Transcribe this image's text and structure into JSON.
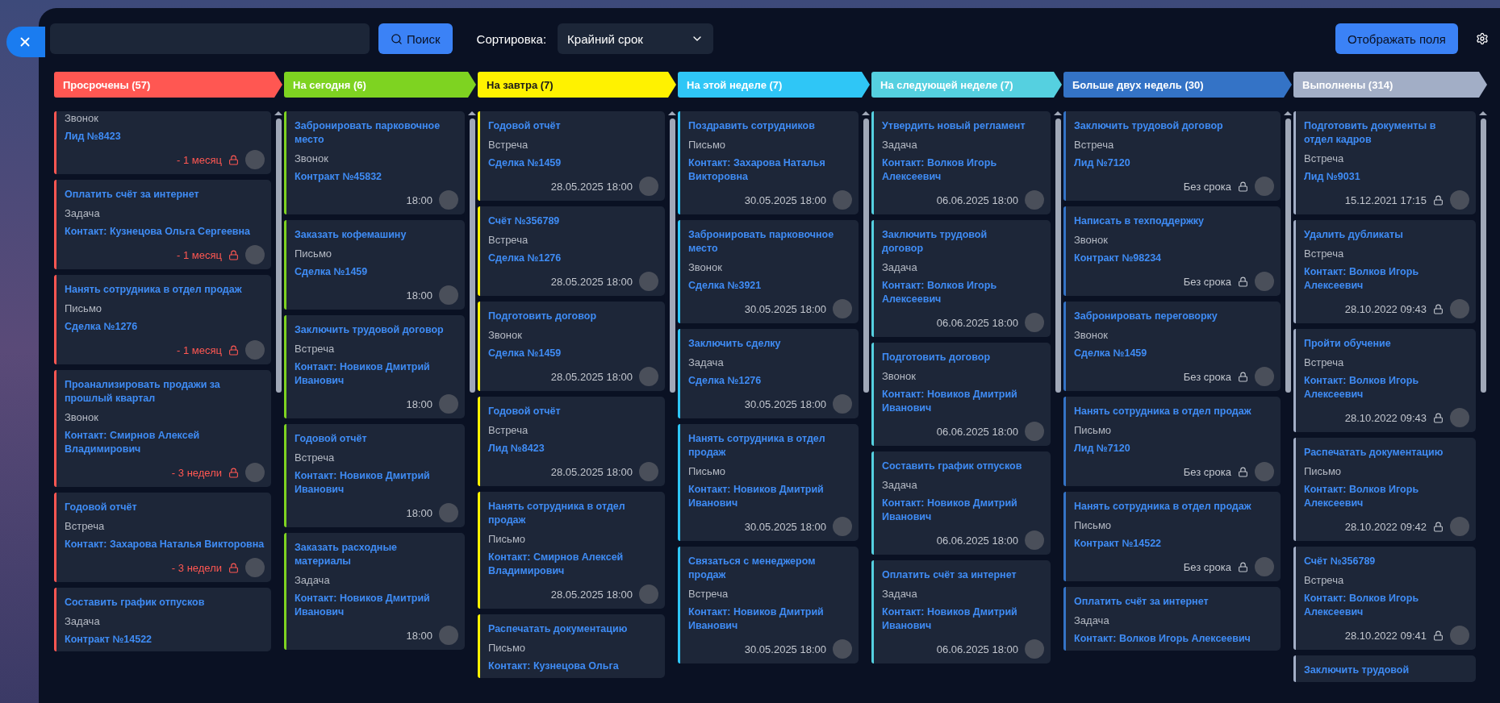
{
  "toolbar": {
    "search_button": "Поиск",
    "sort_label": "Сортировка:",
    "sort_value": "Крайний срок",
    "fields_button": "Отображать поля"
  },
  "columns": [
    {
      "title": "Просрочены (57)",
      "color": "#ff5752",
      "overdue": true,
      "cards": [
        {
          "type": "Звонок",
          "link": "Лид №8423",
          "due": "- 1 месяц",
          "locked": true
        },
        {
          "title": "Оплатить счёт за интернет",
          "type": "Задача",
          "link": "Контакт: Кузнецова Ольга Сергеевна",
          "due": "- 1 месяц",
          "locked": true
        },
        {
          "title": "Нанять сотрудника в отдел продаж",
          "type": "Письмо",
          "link": "Сделка №1276",
          "due": "- 1 месяц",
          "locked": true
        },
        {
          "title": "Проанализировать продажи за прошлый квартал",
          "type": "Звонок",
          "link": "Контакт: Смирнов Алексей Владимирович",
          "due": "- 3 недели",
          "locked": true
        },
        {
          "title": "Годовой отчёт",
          "type": "Встреча",
          "link": "Контакт: Захарова Наталья Викторовна",
          "due": "- 3 недели",
          "locked": true
        },
        {
          "title": "Составить график отпусков",
          "type": "Задача",
          "link": "Контракт №14522"
        }
      ]
    },
    {
      "title": "На сегодня (6)",
      "color": "#7ed321",
      "overdue": false,
      "cards": [
        {
          "title": "Забронировать парковочное место",
          "type": "Звонок",
          "link": "Контракт №45832",
          "due": "18:00",
          "locked": false
        },
        {
          "title": "Заказать кофемашину",
          "type": "Письмо",
          "link": "Сделка №1459",
          "due": "18:00",
          "locked": false
        },
        {
          "title": "Заключить трудовой договор",
          "type": "Встреча",
          "link": "Контакт: Новиков Дмитрий Иванович",
          "due": "18:00",
          "locked": false
        },
        {
          "title": "Годовой отчёт",
          "type": "Встреча",
          "link": "Контакт: Новиков Дмитрий Иванович",
          "due": "18:00",
          "locked": false
        },
        {
          "title": "Заказать расходные материалы",
          "type": "Задача",
          "link": "Контакт: Новиков Дмитрий Иванович",
          "due": "18:00",
          "locked": false
        }
      ]
    },
    {
      "title": "На завтра (7)",
      "color": "#fff200",
      "overdue": false,
      "cards": [
        {
          "title": "Годовой отчёт",
          "type": "Встреча",
          "link": "Сделка №1459",
          "due": "28.05.2025 18:00",
          "locked": false
        },
        {
          "title": "Счёт №356789",
          "type": "Встреча",
          "link": "Сделка №1276",
          "due": "28.05.2025 18:00",
          "locked": false
        },
        {
          "title": "Подготовить договор",
          "type": "Звонок",
          "link": "Сделка №1459",
          "due": "28.05.2025 18:00",
          "locked": false
        },
        {
          "title": "Годовой отчёт",
          "type": "Встреча",
          "link": "Лид №8423",
          "due": "28.05.2025 18:00",
          "locked": false
        },
        {
          "title": "Нанять сотрудника в отдел продаж",
          "type": "Письмо",
          "link": "Контакт: Смирнов Алексей Владимирович",
          "due": "28.05.2025 18:00",
          "locked": false
        },
        {
          "title": "Распечатать документацию",
          "type": "Письмо",
          "link": "Контакт: Кузнецова Ольга"
        }
      ]
    },
    {
      "title": "На этой неделе (7)",
      "color": "#2fc6f6",
      "overdue": false,
      "cards": [
        {
          "title": "Поздравить сотрудников",
          "type": "Письмо",
          "link": "Контакт: Захарова Наталья Викторовна",
          "due": "30.05.2025 18:00",
          "locked": false
        },
        {
          "title": "Забронировать парковочное место",
          "type": "Звонок",
          "link": "Сделка №3921",
          "due": "30.05.2025 18:00",
          "locked": false
        },
        {
          "title": "Заключить сделку",
          "type": "Задача",
          "link": "Сделка №1276",
          "due": "30.05.2025 18:00",
          "locked": false
        },
        {
          "title": "Нанять сотрудника в отдел продаж",
          "type": "Письмо",
          "link": "Контакт: Новиков Дмитрий Иванович",
          "due": "30.05.2025 18:00",
          "locked": false
        },
        {
          "title": "Связаться с менеджером продаж",
          "type": "Встреча",
          "link": "Контакт: Новиков Дмитрий Иванович",
          "due": "30.05.2025 18:00",
          "locked": false
        }
      ]
    },
    {
      "title": "На следующей неделе (7)",
      "color": "#55d0e0",
      "overdue": false,
      "cards": [
        {
          "title": "Утвердить новый регламент",
          "type": "Задача",
          "link": "Контакт: Волков Игорь Алексеевич",
          "due": "06.06.2025 18:00",
          "locked": false
        },
        {
          "title": "Заключить трудовой договор",
          "type": "Задача",
          "link": "Контакт: Волков Игорь Алексеевич",
          "due": "06.06.2025 18:00",
          "locked": false
        },
        {
          "title": "Подготовить договор",
          "type": "Звонок",
          "link": "Контакт: Новиков Дмитрий Иванович",
          "due": "06.06.2025 18:00",
          "locked": false
        },
        {
          "title": "Составить график отпусков",
          "type": "Задача",
          "link": "Контакт: Новиков Дмитрий Иванович",
          "due": "06.06.2025 18:00",
          "locked": false
        },
        {
          "title": "Оплатить счёт за интернет",
          "type": "Задача",
          "link": "Контакт: Новиков Дмитрий Иванович",
          "due": "06.06.2025 18:00",
          "locked": false
        }
      ]
    },
    {
      "title": "Больше двух недель (30)",
      "color": "#3473c6",
      "overdue": false,
      "cards": [
        {
          "title": "Заключить трудовой договор",
          "type": "Встреча",
          "link": "Лид №7120",
          "due": "Без срока",
          "locked": true
        },
        {
          "title": "Написать в техподдержку",
          "type": "Звонок",
          "link": "Контракт №98234",
          "due": "Без срока",
          "locked": true
        },
        {
          "title": "Забронировать переговорку",
          "type": "Звонок",
          "link": "Сделка №1459",
          "due": "Без срока",
          "locked": true
        },
        {
          "title": "Нанять сотрудника в отдел продаж",
          "type": "Письмо",
          "link": "Лид №7120",
          "due": "Без срока",
          "locked": true
        },
        {
          "title": "Нанять сотрудника в отдел продаж",
          "type": "Письмо",
          "link": "Контракт №14522",
          "due": "Без срока",
          "locked": true
        },
        {
          "title": "Оплатить счёт за интернет",
          "type": "Задача",
          "link": "Контакт: Волков Игорь Алексеевич"
        }
      ]
    },
    {
      "title": "Выполнены (314)",
      "color": "#a2aec6",
      "overdue": false,
      "cards": [
        {
          "title": "Подготовить документы в отдел кадров",
          "type": "Встреча",
          "link": "Лид №9031",
          "due": "15.12.2021 17:15",
          "locked": true
        },
        {
          "title": "Удалить дубликаты",
          "type": "Встреча",
          "link": "Контакт: Волков Игорь Алексеевич",
          "due": "28.10.2022 09:43",
          "locked": true
        },
        {
          "title": "Пройти обучение",
          "type": "Встреча",
          "link": "Контакт: Волков Игорь Алексеевич",
          "due": "28.10.2022 09:43",
          "locked": true
        },
        {
          "title": "Распечатать документацию",
          "type": "Письмо",
          "link": "Контакт: Волков Игорь Алексеевич",
          "due": "28.10.2022 09:42",
          "locked": true
        },
        {
          "title": "Счёт №356789",
          "type": "Встреча",
          "link": "Контакт: Волков Игорь Алексеевич",
          "due": "28.10.2022 09:41",
          "locked": true
        },
        {
          "title": "Заключить трудовой"
        }
      ]
    }
  ]
}
